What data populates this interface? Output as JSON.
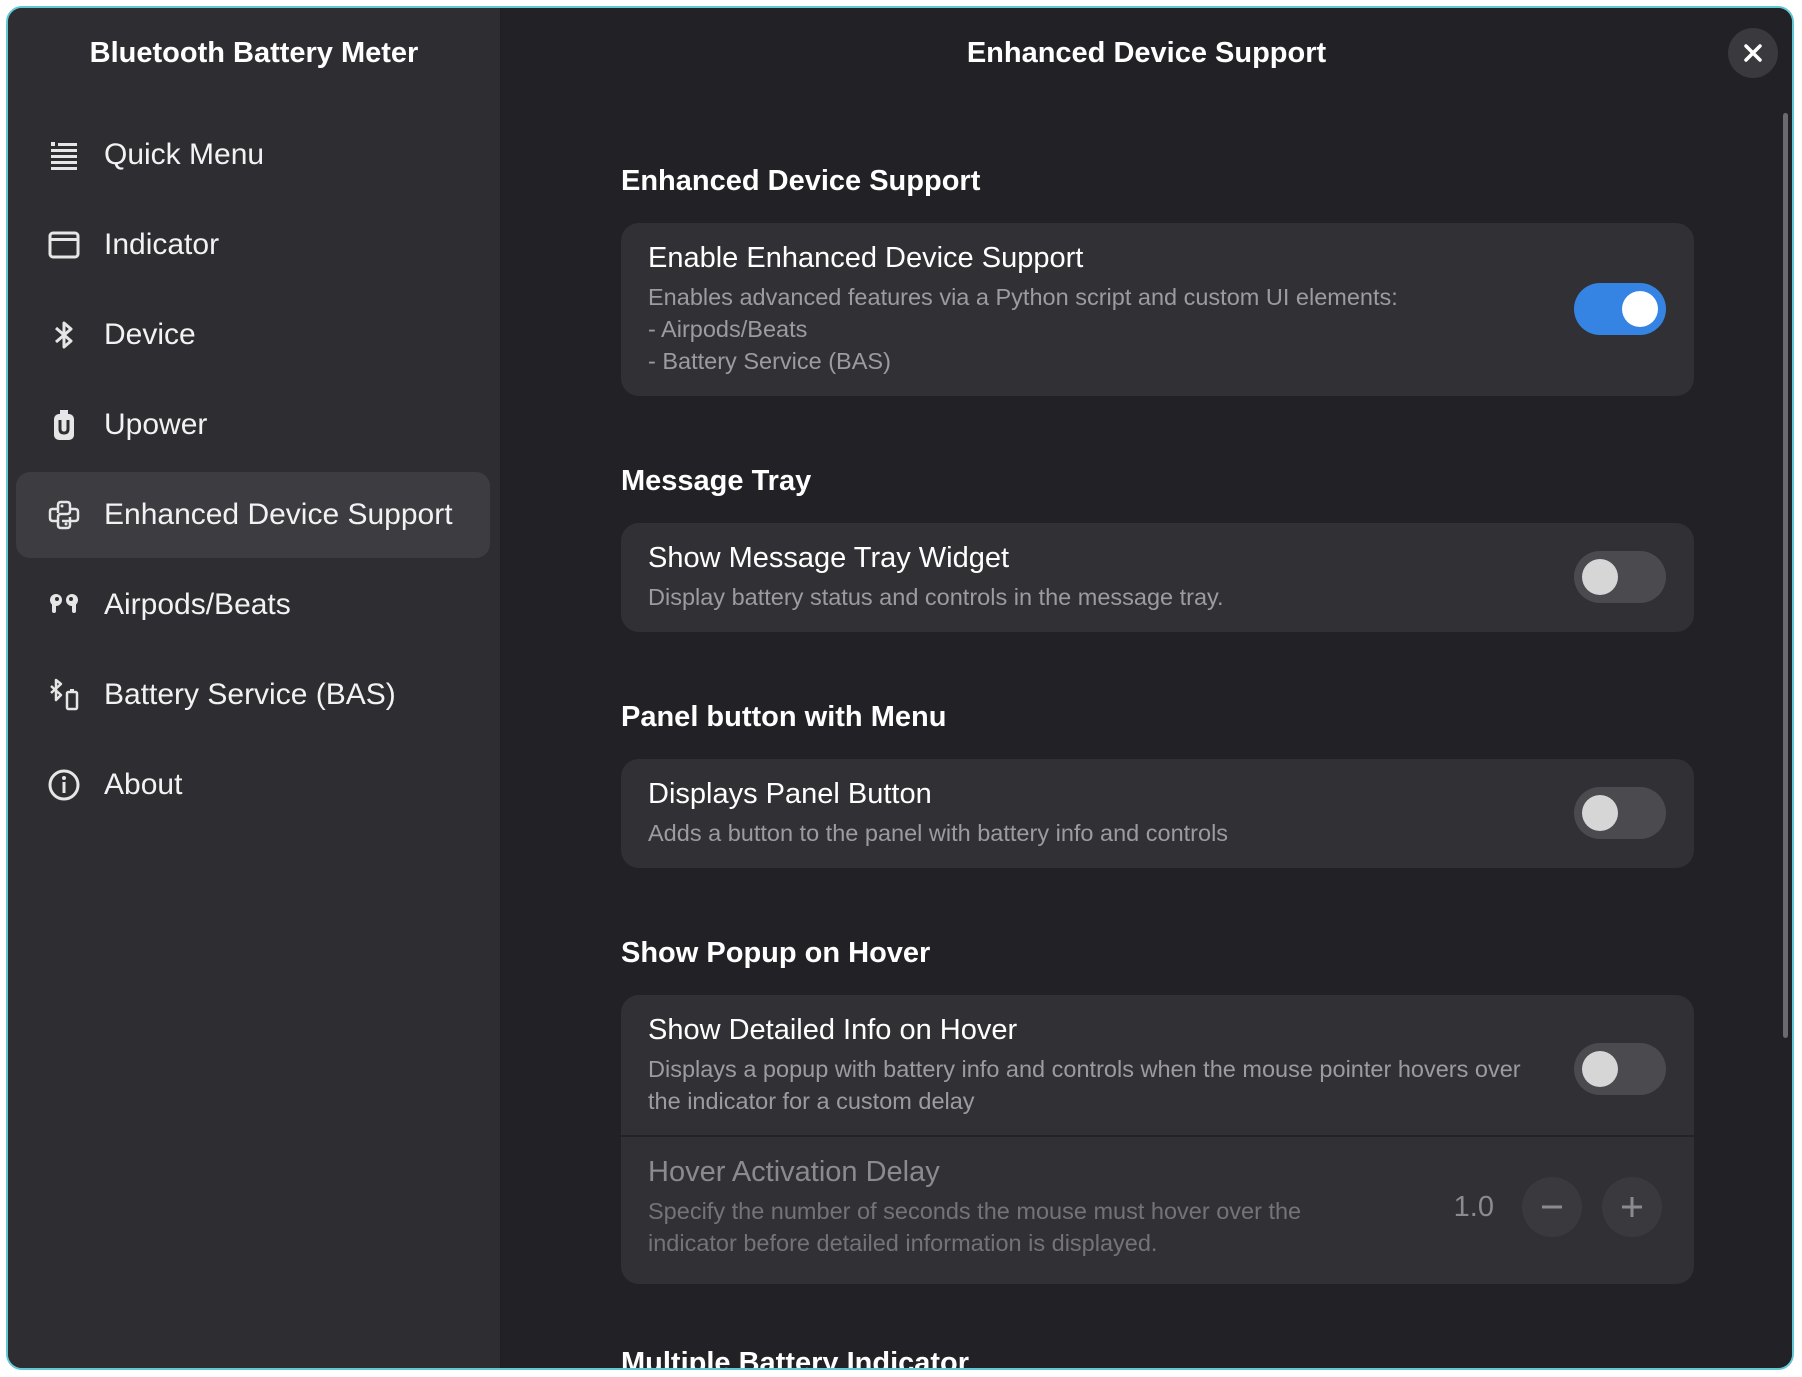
{
  "sidebar": {
    "title": "Bluetooth Battery Meter",
    "items": [
      {
        "label": "Quick Menu",
        "icon": "quick-menu-icon"
      },
      {
        "label": "Indicator",
        "icon": "indicator-icon"
      },
      {
        "label": "Device",
        "icon": "bluetooth-icon"
      },
      {
        "label": "Upower",
        "icon": "upower-icon"
      },
      {
        "label": "Enhanced Device Support",
        "icon": "python-icon",
        "active": true
      },
      {
        "label": "Airpods/Beats",
        "icon": "earbuds-icon"
      },
      {
        "label": "Battery Service (BAS)",
        "icon": "bluetooth-battery-icon"
      },
      {
        "label": "About",
        "icon": "info-icon"
      }
    ]
  },
  "header": {
    "title": "Enhanced Device Support",
    "close_icon": "close-icon"
  },
  "groups": {
    "enhanced": {
      "title": "Enhanced Device Support",
      "row": {
        "title": "Enable Enhanced Device Support",
        "sub1": "Enables advanced features via a Python script and custom UI elements:",
        "sub2": "- Airpods/Beats",
        "sub3": "- Battery Service (BAS)",
        "enabled": true
      }
    },
    "tray": {
      "title": "Message Tray",
      "row": {
        "title": "Show Message Tray Widget",
        "sub1": "Display battery status and controls in the message tray.",
        "enabled": false
      }
    },
    "panel": {
      "title": "Panel button with Menu",
      "row": {
        "title": "Displays Panel Button",
        "sub1": "Adds a button to the panel with battery info and controls",
        "enabled": false
      }
    },
    "popup": {
      "title": "Show Popup on Hover",
      "row": {
        "title": "Show Detailed Info on Hover",
        "sub1": "Displays a popup with battery info and controls when the mouse pointer hovers over",
        "sub2": "the indicator for a custom delay",
        "enabled": false
      },
      "delay": {
        "title": "Hover Activation Delay",
        "sub1": "Specify the number of seconds the mouse must hover over the",
        "sub2": "indicator before detailed information is displayed.",
        "value": "1.0"
      }
    },
    "multi": {
      "title": "Multiple Battery Indicator"
    }
  },
  "colors": {
    "accent": "#3584e4",
    "window_border": "#62c8d6"
  }
}
